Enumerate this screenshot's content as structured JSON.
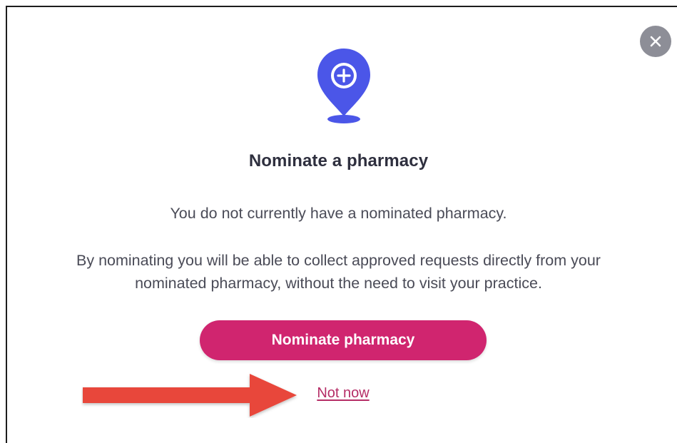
{
  "modal": {
    "title": "Nominate a pharmacy",
    "message_primary": "You do not currently have a nominated pharmacy.",
    "message_secondary_line1": "By nominating you will be able to collect approved requests directly from your",
    "message_secondary_line2": "nominated pharmacy, without the need to visit your practice.",
    "primary_button_label": "Nominate pharmacy",
    "secondary_link_label": "Not now",
    "close_icon": "close-icon",
    "header_icon": "location-pin-plus-icon"
  },
  "annotation": {
    "icon": "red-arrow-right-icon",
    "color": "#e8463a"
  },
  "colors": {
    "accent": "#d0256f",
    "pin": "#4b56e8",
    "close_bg": "#8d8e97",
    "link": "#b52d66",
    "title": "#2e2f3e",
    "body_text": "#4a4b57"
  }
}
